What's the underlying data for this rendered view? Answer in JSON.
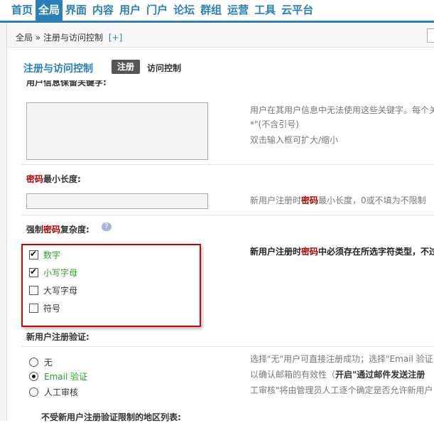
{
  "nav": {
    "items": [
      "首页",
      "全局",
      "界面",
      "内容",
      "用户",
      "门户",
      "论坛",
      "群组",
      "运营",
      "工具",
      "云平台"
    ],
    "active_index": 1,
    "accent": "#2b7fb6"
  },
  "breadcrumb": {
    "root": "全局",
    "sep": "»",
    "current": "注册与访问控制",
    "add": "[+]"
  },
  "page": {
    "title": "注册与访问控制",
    "tab_active": "注册",
    "tab_next": "访问控制"
  },
  "fields": {
    "keywords": {
      "label_partial": "用户信息保留关键字:",
      "tip1": "用户在其用户信息中无法使用这些关键字。每个关",
      "tip2": "*\"(不含引号)",
      "tip3": "双击输入框可扩大/缩小"
    },
    "pwlen": {
      "label_a": "密码",
      "label_b": "最小长度:",
      "tip_a": "新用户注册时",
      "tip_b": "密码",
      "tip_c": "最小长度，0或不填为不限制"
    },
    "complexity": {
      "label_a": "强制",
      "label_b": "密码",
      "label_c": "复杂度:",
      "tip_a": "新用户注册时",
      "tip_b": "密码",
      "tip_c": "中必须存在所选字符类型，不过",
      "options": [
        {
          "label": "数字",
          "checked": true
        },
        {
          "label": "小写字母",
          "checked": true
        },
        {
          "label": "大写字母",
          "checked": false
        },
        {
          "label": "符号",
          "checked": false
        }
      ]
    },
    "verify": {
      "label": "新用户注册验证:",
      "tip1": "选择\"无\"用户可直接注册成功；选择\"Email 验证",
      "tip2a": "以确认邮箱的有效性（",
      "tip2b": "开启\"通过邮件发送注册",
      "tip3": "工审核\"将由管理员人工逐个确定是否允许新用户",
      "options": [
        {
          "label": "无",
          "selected": false
        },
        {
          "label": "Email 验证",
          "selected": true
        },
        {
          "label": "人工审核",
          "selected": false
        }
      ]
    },
    "region": {
      "label": "不受新用户注册验证限制的地区列表:"
    }
  }
}
